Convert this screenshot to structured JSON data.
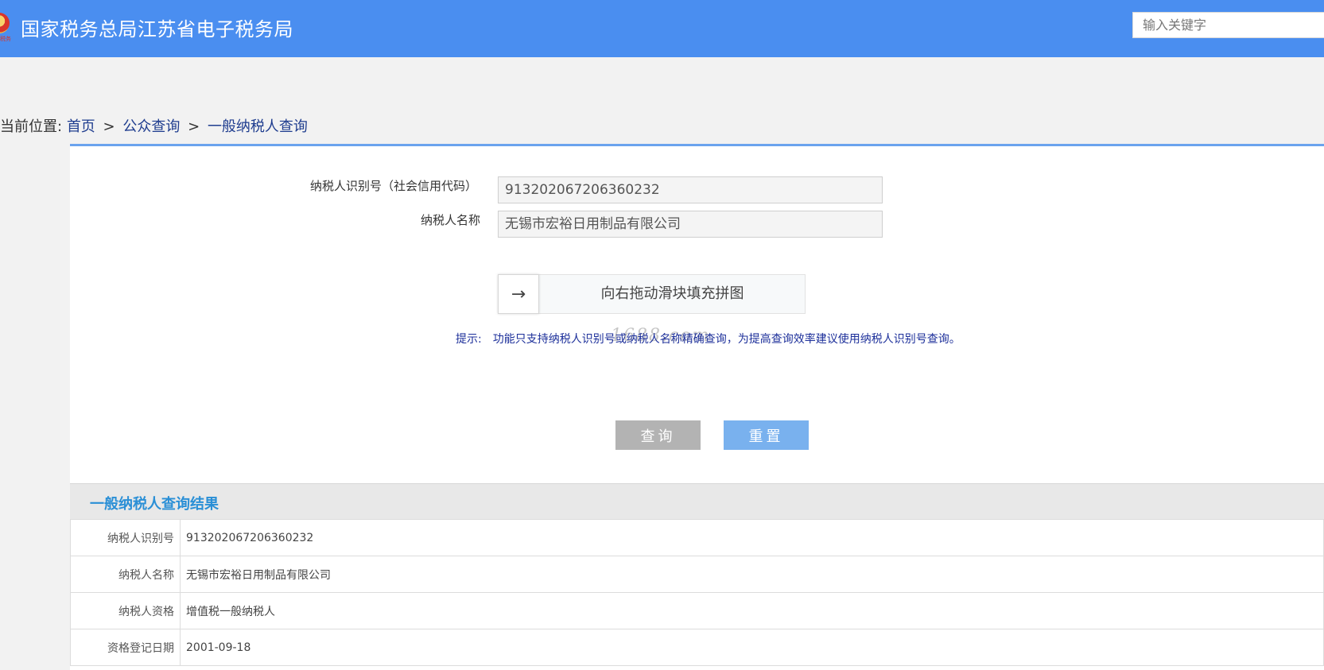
{
  "header": {
    "site_title": "国家税务总局江苏省电子税务局",
    "search_placeholder": "输入关键字",
    "logo_sub": "税务"
  },
  "breadcrumb": {
    "prefix": "当前位置:",
    "items": [
      "首页",
      "公众查询",
      "一般纳税人查询"
    ],
    "separator": ">"
  },
  "form": {
    "taxpayer_id_label": "纳税人识别号（社会信用代码）",
    "taxpayer_id_value": "913202067206360232",
    "taxpayer_name_label": "纳税人名称",
    "taxpayer_name_value": "无锡市宏裕日用制品有限公司",
    "slider_text": "向右拖动滑块填充拼图",
    "slider_icon": "arrow-right-icon",
    "hint_label": "提示:",
    "hint_text": "功能只支持纳税人识别号或纳税人名称精确查询，为提高查询效率建议使用纳税人识别号查询。",
    "watermark": "1688.com",
    "query_button": "查询",
    "reset_button": "重置"
  },
  "results": {
    "title": "一般纳税人查询结果",
    "rows": [
      {
        "label": "纳税人识别号",
        "value": "913202067206360232"
      },
      {
        "label": "纳税人名称",
        "value": "无锡市宏裕日用制品有限公司"
      },
      {
        "label": "纳税人资格",
        "value": "增值税一般纳税人"
      },
      {
        "label": "资格登记日期",
        "value": "2001-09-18"
      }
    ]
  },
  "colors": {
    "header_bg": "#4a8ef0",
    "accent_blue": "#2a8fd6",
    "query_button": "#b3b3b3",
    "reset_button": "#79b1ee"
  }
}
